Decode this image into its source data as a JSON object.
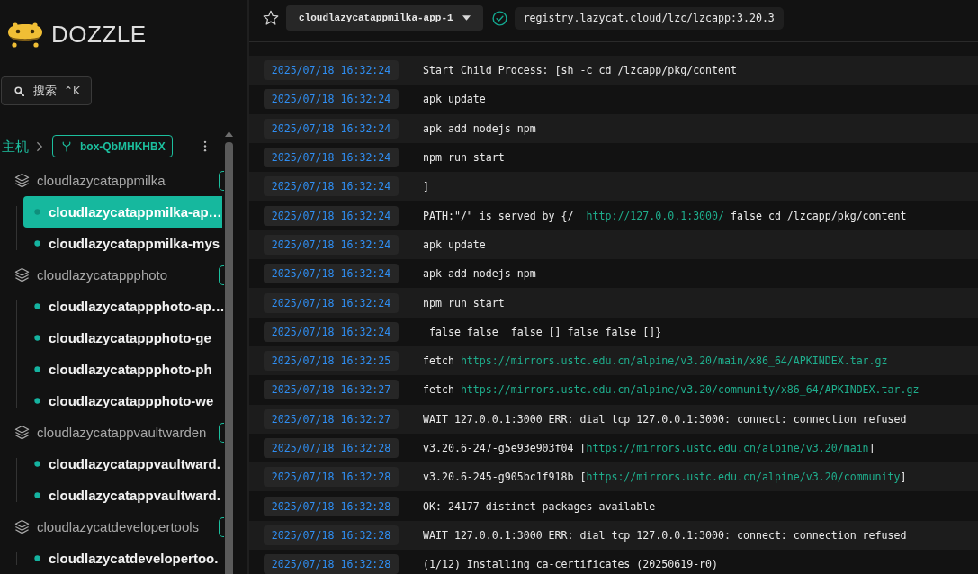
{
  "sidebar": {
    "brand": "DOZZLE",
    "search": {
      "label": "搜索",
      "shortcut": "⌃K"
    },
    "breadcrumb": {
      "root": "主机",
      "host": "box-QbMHKHBX"
    },
    "groups": [
      {
        "name": "cloudlazycatappmilka",
        "children": [
          {
            "label": "cloudlazycatappmilka-ap…",
            "selected": true
          },
          {
            "label": "cloudlazycatappmilka-mys",
            "selected": false
          }
        ]
      },
      {
        "name": "cloudlazycatappphoto",
        "children": [
          {
            "label": "cloudlazycatappphoto-ap…",
            "selected": false
          },
          {
            "label": "cloudlazycatappphoto-ge",
            "selected": false
          },
          {
            "label": "cloudlazycatappphoto-ph",
            "selected": false
          },
          {
            "label": "cloudlazycatappphoto-we",
            "selected": false
          }
        ]
      },
      {
        "name": "cloudlazycatappvaultwarden",
        "children": [
          {
            "label": "cloudlazycatappvaultward.",
            "selected": false
          },
          {
            "label": "cloudlazycatappvaultward.",
            "selected": false
          }
        ]
      },
      {
        "name": "cloudlazycatdevelopertools",
        "children": [
          {
            "label": "cloudlazycatdevelopertoo.",
            "selected": false
          }
        ]
      }
    ]
  },
  "header": {
    "starred": false,
    "container": "cloudlazycatappmilka-app-1",
    "image": "registry.lazycat.cloud/lzc/lzcapp:3.20.3"
  },
  "logs": [
    {
      "time": "2025/07/18 16:32:24",
      "segments": [
        {
          "kind": "text",
          "text": "Start Child Process: [sh -c cd /lzcapp/pkg/content"
        }
      ]
    },
    {
      "time": "2025/07/18 16:32:24",
      "segments": [
        {
          "kind": "text",
          "text": "apk update"
        }
      ]
    },
    {
      "time": "2025/07/18 16:32:24",
      "segments": [
        {
          "kind": "text",
          "text": "apk add nodejs npm"
        }
      ]
    },
    {
      "time": "2025/07/18 16:32:24",
      "segments": [
        {
          "kind": "text",
          "text": "npm run start"
        }
      ]
    },
    {
      "time": "2025/07/18 16:32:24",
      "segments": [
        {
          "kind": "text",
          "text": "]"
        }
      ]
    },
    {
      "time": "2025/07/18 16:32:24",
      "segments": [
        {
          "kind": "text",
          "text": "PATH:\"/\" is served by {/  "
        },
        {
          "kind": "link",
          "text": "http://127.0.0.1:3000/"
        },
        {
          "kind": "text",
          "text": " false cd /lzcapp/pkg/content"
        }
      ]
    },
    {
      "time": "2025/07/18 16:32:24",
      "segments": [
        {
          "kind": "text",
          "text": "apk update"
        }
      ]
    },
    {
      "time": "2025/07/18 16:32:24",
      "segments": [
        {
          "kind": "text",
          "text": "apk add nodejs npm"
        }
      ]
    },
    {
      "time": "2025/07/18 16:32:24",
      "segments": [
        {
          "kind": "text",
          "text": "npm run start"
        }
      ]
    },
    {
      "time": "2025/07/18 16:32:24",
      "segments": [
        {
          "kind": "text",
          "text": " false false  false [] false false []}"
        }
      ]
    },
    {
      "time": "2025/07/18 16:32:25",
      "segments": [
        {
          "kind": "text",
          "text": "fetch "
        },
        {
          "kind": "link",
          "text": "https://mirrors.ustc.edu.cn/alpine/v3.20/main/x86_64/APKINDEX.tar.gz"
        }
      ]
    },
    {
      "time": "2025/07/18 16:32:27",
      "segments": [
        {
          "kind": "text",
          "text": "fetch "
        },
        {
          "kind": "link",
          "text": "https://mirrors.ustc.edu.cn/alpine/v3.20/community/x86_64/APKINDEX.tar.gz"
        }
      ]
    },
    {
      "time": "2025/07/18 16:32:27",
      "segments": [
        {
          "kind": "text",
          "text": "WAIT 127.0.0.1:3000 ERR: dial tcp 127.0.0.1:3000: connect: connection refused"
        }
      ]
    },
    {
      "time": "2025/07/18 16:32:28",
      "segments": [
        {
          "kind": "text",
          "text": "v3.20.6-247-g5e93e903f04 ["
        },
        {
          "kind": "link",
          "text": "https://mirrors.ustc.edu.cn/alpine/v3.20/main"
        },
        {
          "kind": "text",
          "text": "]"
        }
      ]
    },
    {
      "time": "2025/07/18 16:32:28",
      "segments": [
        {
          "kind": "text",
          "text": "v3.20.6-245-g905bc1f918b ["
        },
        {
          "kind": "link",
          "text": "https://mirrors.ustc.edu.cn/alpine/v3.20/community"
        },
        {
          "kind": "text",
          "text": "]"
        }
      ]
    },
    {
      "time": "2025/07/18 16:32:28",
      "segments": [
        {
          "kind": "text",
          "text": "OK: 24177 distinct packages available"
        }
      ]
    },
    {
      "time": "2025/07/18 16:32:28",
      "segments": [
        {
          "kind": "text",
          "text": "WAIT 127.0.0.1:3000 ERR: dial tcp 127.0.0.1:3000: connect: connection refused"
        }
      ]
    },
    {
      "time": "2025/07/18 16:32:28",
      "segments": [
        {
          "kind": "text",
          "text": "(1/12) Installing ca-certificates (20250619-r0)"
        }
      ]
    }
  ]
}
